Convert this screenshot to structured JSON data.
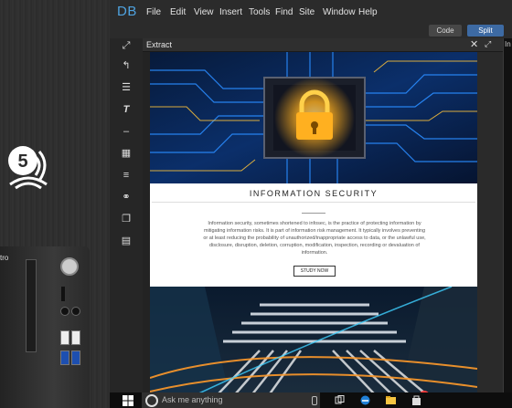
{
  "background": {
    "badge_glyph": "5",
    "tower_label": "tro"
  },
  "app": {
    "logo": "DB",
    "menu": [
      "File",
      "Edit",
      "View",
      "Insert",
      "Tools",
      "Find",
      "Site",
      "Window",
      "Help"
    ],
    "view_buttons": {
      "code": "Code",
      "split": "Split"
    },
    "panel_title": "Extract",
    "right_panel_label": "In",
    "tools": [
      "fullscreen-icon",
      "undo-icon",
      "sliders-icon",
      "text-format-icon",
      "minus-icon",
      "grid-icon",
      "list-icon",
      "link-icon",
      "layers-icon",
      "document-icon"
    ]
  },
  "document": {
    "section_title": "INFORMATION SECURITY",
    "paragraph": "Information security, sometimes shortened to infosec, is the practice of protecting information by mitigating information risks. It is part of information risk management. It typically involves preventing or at least reducing the probability of unauthorized/inappropriate access to data, or the unlawful use, disclosure, disruption, deletion, corruption, modification, inspection, recording or devaluation of information.",
    "button": "STUDY NOW"
  },
  "taskbar": {
    "search_placeholder": "Ask me anything"
  },
  "colors": {
    "accent": "#4fa3e0",
    "split_button": "#3d6aa3",
    "lock_glow": "#ffb020",
    "circuit": "#1e6fd0"
  }
}
